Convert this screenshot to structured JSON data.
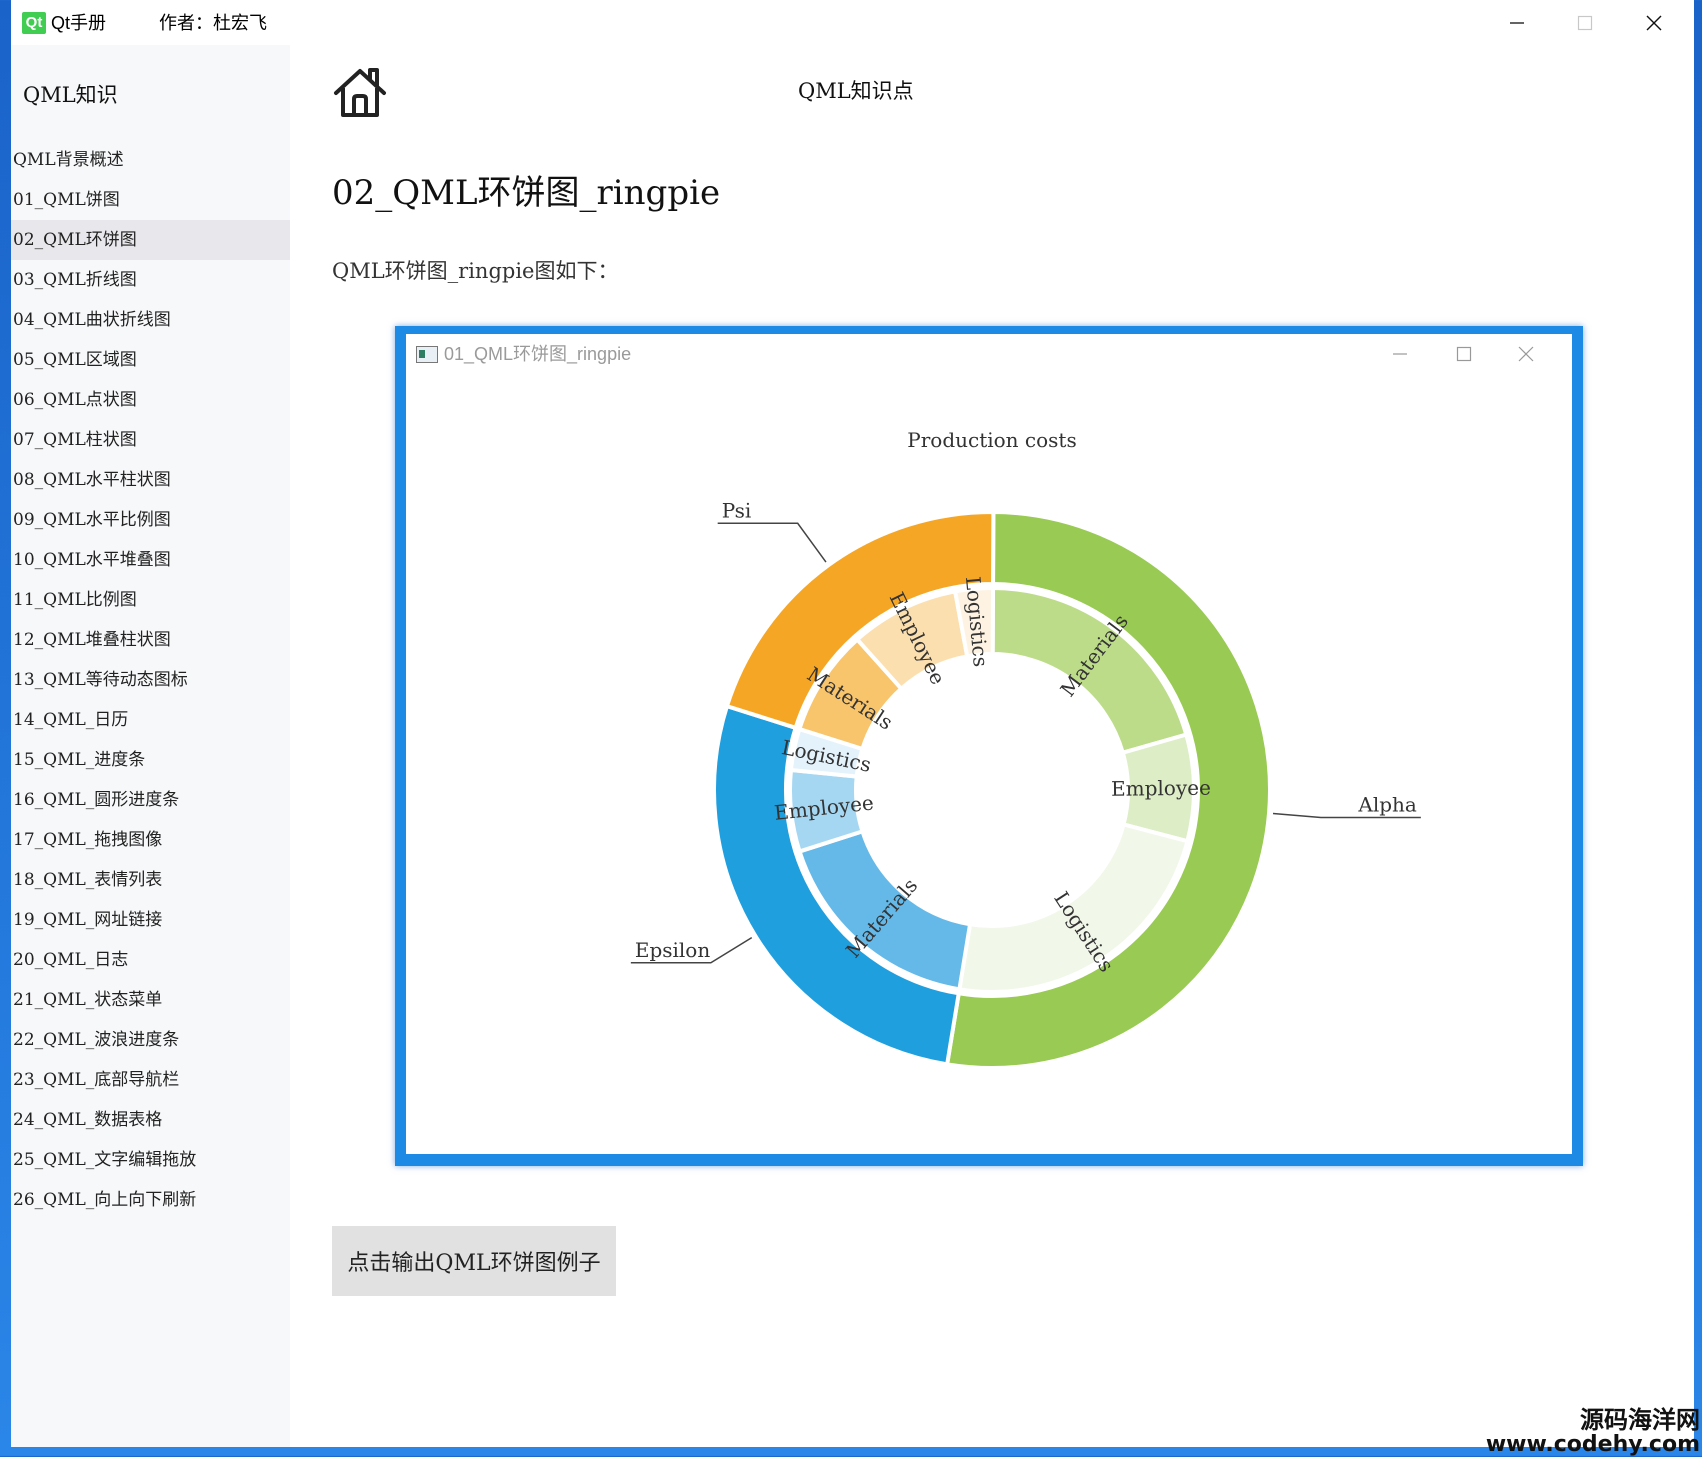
{
  "window": {
    "app_title": "Qt手册",
    "author": "作者：杜宏飞"
  },
  "sidebar": {
    "title": "QML知识",
    "items": [
      "QML背景概述",
      "01_QML饼图",
      "02_QML环饼图",
      "03_QML折线图",
      "04_QML曲状折线图",
      "05_QML区域图",
      "06_QML点状图",
      "07_QML柱状图",
      "08_QML水平柱状图",
      "09_QML水平比例图",
      "10_QML水平堆叠图",
      "11_QML比例图",
      "12_QML堆叠柱状图",
      "13_QML等待动态图标",
      "14_QML_日历",
      "15_QML_进度条",
      "16_QML_圆形进度条",
      "17_QML_拖拽图像",
      "18_QML_表情列表",
      "19_QML_网址链接",
      "20_QML_日志",
      "21_QML_状态菜单",
      "22_QML_波浪进度条",
      "23_QML_底部导航栏",
      "24_QML_数据表格",
      "25_QML_文字编辑拖放",
      "26_QML_向上向下刷新"
    ],
    "active_index": 2
  },
  "header": {
    "title": "QML知识点"
  },
  "content": {
    "page_title": "02_QML环饼图_ringpie",
    "description": "QML环饼图_ringpie图如下：",
    "button_label": "点击输出QML环饼图例子"
  },
  "demo_window": {
    "title": "01_QML环饼图_ringpie"
  },
  "chart_data": {
    "type": "pie",
    "title": "Production costs",
    "outer": [
      {
        "name": "Alpha",
        "value": 52.5,
        "color": "#99ca53"
      },
      {
        "name": "Epsilon",
        "value": 27.3,
        "color": "#209fdf"
      },
      {
        "name": "Psi",
        "value": 20.2,
        "color": "#f6a625"
      }
    ],
    "inner": [
      {
        "category": "Alpha",
        "label": "Materials",
        "value": 20.5,
        "color": "#bddc8a"
      },
      {
        "category": "Alpha",
        "label": "Employee",
        "value": 8.5,
        "color": "#ddedc6"
      },
      {
        "category": "Alpha",
        "label": "Logistics",
        "value": 23.5,
        "color": "#f1f7e9"
      },
      {
        "category": "Epsilon",
        "label": "Materials",
        "value": 17.5,
        "color": "#65b9e9"
      },
      {
        "category": "Epsilon",
        "label": "Employee",
        "value": 6.5,
        "color": "#a6d7f2"
      },
      {
        "category": "Epsilon",
        "label": "Logistics",
        "value": 3.3,
        "color": "#e3f2fb"
      },
      {
        "category": "Psi",
        "label": "Materials",
        "value": 8.5,
        "color": "#f8c46c"
      },
      {
        "category": "Psi",
        "label": "Employee",
        "value": 8.7,
        "color": "#fcdfaf"
      },
      {
        "category": "Psi",
        "label": "Logistics",
        "value": 3.0,
        "color": "#fef3e2"
      }
    ]
  },
  "watermark": {
    "line1": "源码海洋网",
    "line2": "www.codehy.com"
  }
}
